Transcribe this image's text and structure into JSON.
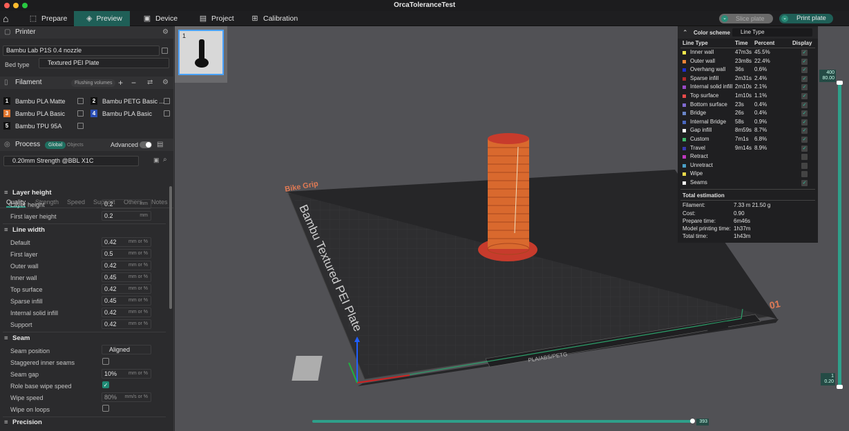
{
  "window": {
    "title": "OrcaToleranceTest"
  },
  "tabs": [
    {
      "label": "Prepare",
      "icon": "prepare-icon"
    },
    {
      "label": "Preview",
      "icon": "preview-icon"
    },
    {
      "label": "Device",
      "icon": "device-icon"
    },
    {
      "label": "Project",
      "icon": "project-icon"
    },
    {
      "label": "Calibration",
      "icon": "calibration-icon"
    }
  ],
  "actions": {
    "slice": "Slice plate",
    "print": "Print plate"
  },
  "printer": {
    "section": "Printer",
    "name": "Bambu Lab P1S 0.4 nozzle",
    "bed_type_label": "Bed type",
    "bed_type": "Textured PEI Plate"
  },
  "filament": {
    "section": "Filament",
    "flushing": "Flushing volumes",
    "slots": [
      {
        "num": "1",
        "name": "Bambu PLA Matte",
        "color": "#111111"
      },
      {
        "num": "2",
        "name": "Bambu PETG Basic ...",
        "color": "#111111"
      },
      {
        "num": "3",
        "name": "Bambu PLA Basic",
        "color": "#e0752d"
      },
      {
        "num": "4",
        "name": "Bambu PLA Basic",
        "color": "#2b4fb5"
      },
      {
        "num": "5",
        "name": "Bambu TPU 95A",
        "color": "#111111"
      }
    ]
  },
  "process": {
    "section": "Process",
    "global": "Global",
    "objects": "Objects",
    "advanced": "Advanced",
    "preset": "0.20mm Strength @BBL X1C",
    "tabs": [
      "Quality",
      "Strength",
      "Speed",
      "Support",
      "Others",
      "Notes"
    ],
    "layer_height": {
      "title": "Layer height",
      "rows": [
        {
          "label": "Layer height",
          "value": "0.2",
          "unit": "mm"
        },
        {
          "label": "First layer height",
          "value": "0.2",
          "unit": "mm"
        }
      ]
    },
    "line_width": {
      "title": "Line width",
      "rows": [
        {
          "label": "Default",
          "value": "0.42",
          "unit": "mm or %"
        },
        {
          "label": "First layer",
          "value": "0.5",
          "unit": "mm or %"
        },
        {
          "label": "Outer wall",
          "value": "0.42",
          "unit": "mm or %"
        },
        {
          "label": "Inner wall",
          "value": "0.45",
          "unit": "mm or %"
        },
        {
          "label": "Top surface",
          "value": "0.42",
          "unit": "mm or %"
        },
        {
          "label": "Sparse infill",
          "value": "0.45",
          "unit": "mm or %"
        },
        {
          "label": "Internal solid infill",
          "value": "0.42",
          "unit": "mm or %"
        },
        {
          "label": "Support",
          "value": "0.42",
          "unit": "mm or %"
        }
      ]
    },
    "seam": {
      "title": "Seam",
      "seam_position_label": "Seam position",
      "seam_position": "Aligned",
      "staggered_label": "Staggered inner seams",
      "staggered": false,
      "seam_gap_label": "Seam gap",
      "seam_gap": "10%",
      "seam_gap_unit": "mm or %",
      "role_wipe_label": "Role base wipe speed",
      "role_wipe": true,
      "wipe_speed_label": "Wipe speed",
      "wipe_speed": "80%",
      "wipe_speed_unit": "mm/s or %",
      "wipe_loops_label": "Wipe on loops",
      "wipe_loops": false
    },
    "precision": {
      "title": "Precision"
    }
  },
  "plate": {
    "number": "1",
    "label_name": "Bike Grip",
    "bed_text": "Bambu Textured PEI Plate",
    "corner_num": "01",
    "strip_text": "PLA/ABS/PETG"
  },
  "legend": {
    "title": "Color scheme",
    "scheme": "Line Type",
    "headers": {
      "type": "Line Type",
      "time": "Time",
      "percent": "Percent",
      "display": "Display"
    },
    "rows": [
      {
        "name": "Inner wall",
        "time": "47m3s",
        "percent": "45.5%",
        "color": "#f2e84b",
        "shown": true
      },
      {
        "name": "Outer wall",
        "time": "23m8s",
        "percent": "22.4%",
        "color": "#f08536",
        "shown": true
      },
      {
        "name": "Overhang wall",
        "time": "36s",
        "percent": "0.6%",
        "color": "#2030d0",
        "shown": true
      },
      {
        "name": "Sparse infill",
        "time": "2m31s",
        "percent": "2.4%",
        "color": "#b02a2a",
        "shown": true
      },
      {
        "name": "Internal solid infill",
        "time": "2m10s",
        "percent": "2.1%",
        "color": "#9a4ac8",
        "shown": true
      },
      {
        "name": "Top surface",
        "time": "1m10s",
        "percent": "1.1%",
        "color": "#e84a4a",
        "shown": true
      },
      {
        "name": "Bottom surface",
        "time": "23s",
        "percent": "0.4%",
        "color": "#7f6ad0",
        "shown": true
      },
      {
        "name": "Bridge",
        "time": "26s",
        "percent": "0.4%",
        "color": "#6a86c8",
        "shown": true
      },
      {
        "name": "Internal Bridge",
        "time": "58s",
        "percent": "0.9%",
        "color": "#4a68c0",
        "shown": true
      },
      {
        "name": "Gap infill",
        "time": "8m59s",
        "percent": "8.7%",
        "color": "#ffffff",
        "shown": true
      },
      {
        "name": "Custom",
        "time": "7m1s",
        "percent": "6.8%",
        "color": "#3fb86a",
        "shown": true
      },
      {
        "name": "Travel",
        "time": "9m14s",
        "percent": "8.9%",
        "color": "#3a3ab0",
        "shown": true
      },
      {
        "name": "Retract",
        "time": "",
        "percent": "",
        "color": "#c038c0",
        "shown": false
      },
      {
        "name": "Unretract",
        "time": "",
        "percent": "",
        "color": "#4aa0c8",
        "shown": false
      },
      {
        "name": "Wipe",
        "time": "",
        "percent": "",
        "color": "#e8d84a",
        "shown": false
      },
      {
        "name": "Seams",
        "time": "",
        "percent": "",
        "color": "#f0f0f0",
        "shown": true
      }
    ],
    "total_title": "Total estimation",
    "totals": [
      {
        "label": "Filament:",
        "value": "7.33 m     21.50 g"
      },
      {
        "label": "Cost:",
        "value": "0.90"
      },
      {
        "label": "Prepare time:",
        "value": "6m46s"
      },
      {
        "label": "Model printing time:",
        "value": "1h37m"
      },
      {
        "label": "Total time:",
        "value": "1h43m"
      }
    ]
  },
  "layer_slider": {
    "top_value": "400",
    "top_height": "80.00",
    "bottom_value": "1",
    "bottom_height": "0.20"
  },
  "move_slider": {
    "value": "393"
  }
}
